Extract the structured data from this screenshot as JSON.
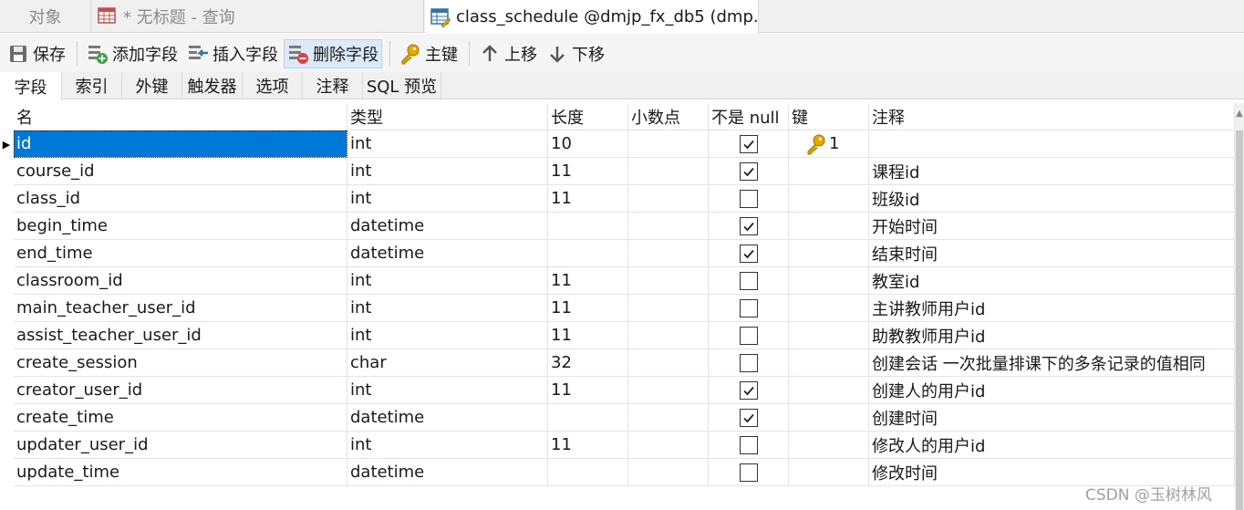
{
  "tabs": {
    "objects_label": "对象",
    "query_label": "* 无标题 - 查询",
    "active_label": "class_schedule @dmjp_fx_db5 (dmp..."
  },
  "toolbar": {
    "save": "保存",
    "add_field": "添加字段",
    "insert_field": "插入字段",
    "delete_field": "删除字段",
    "primary_key": "主键",
    "move_up": "上移",
    "move_down": "下移"
  },
  "subtabs": [
    "字段",
    "索引",
    "外键",
    "触发器",
    "选项",
    "注释",
    "SQL 预览"
  ],
  "columns": {
    "name": "名",
    "type": "类型",
    "length": "长度",
    "decimals": "小数点",
    "not_null": "不是 null",
    "key": "键",
    "comment": "注释"
  },
  "rows": [
    {
      "name": "id",
      "type": "int",
      "length": "10",
      "decimals": "",
      "not_null": true,
      "key": "1",
      "comment": ""
    },
    {
      "name": "course_id",
      "type": "int",
      "length": "11",
      "decimals": "",
      "not_null": true,
      "key": "",
      "comment": "课程id"
    },
    {
      "name": "class_id",
      "type": "int",
      "length": "11",
      "decimals": "",
      "not_null": false,
      "key": "",
      "comment": "班级id"
    },
    {
      "name": "begin_time",
      "type": "datetime",
      "length": "",
      "decimals": "",
      "not_null": true,
      "key": "",
      "comment": "开始时间"
    },
    {
      "name": "end_time",
      "type": "datetime",
      "length": "",
      "decimals": "",
      "not_null": true,
      "key": "",
      "comment": "结束时间"
    },
    {
      "name": "classroom_id",
      "type": "int",
      "length": "11",
      "decimals": "",
      "not_null": false,
      "key": "",
      "comment": "教室id"
    },
    {
      "name": "main_teacher_user_id",
      "type": "int",
      "length": "11",
      "decimals": "",
      "not_null": false,
      "key": "",
      "comment": "主讲教师用户id"
    },
    {
      "name": "assist_teacher_user_id",
      "type": "int",
      "length": "11",
      "decimals": "",
      "not_null": false,
      "key": "",
      "comment": "助教教师用户id"
    },
    {
      "name": "create_session",
      "type": "char",
      "length": "32",
      "decimals": "",
      "not_null": false,
      "key": "",
      "comment": "创建会话 一次批量排课下的多条记录的值相同"
    },
    {
      "name": "creator_user_id",
      "type": "int",
      "length": "11",
      "decimals": "",
      "not_null": true,
      "key": "",
      "comment": "创建人的用户id"
    },
    {
      "name": "create_time",
      "type": "datetime",
      "length": "",
      "decimals": "",
      "not_null": true,
      "key": "",
      "comment": "创建时间"
    },
    {
      "name": "updater_user_id",
      "type": "int",
      "length": "11",
      "decimals": "",
      "not_null": false,
      "key": "",
      "comment": "修改人的用户id"
    },
    {
      "name": "update_time",
      "type": "datetime",
      "length": "",
      "decimals": "",
      "not_null": false,
      "key": "",
      "comment": "修改时间"
    }
  ],
  "watermark": "CSDN @玉树林风",
  "colors": {
    "selection": "#0078d7",
    "key_icon": "#e6a800"
  }
}
